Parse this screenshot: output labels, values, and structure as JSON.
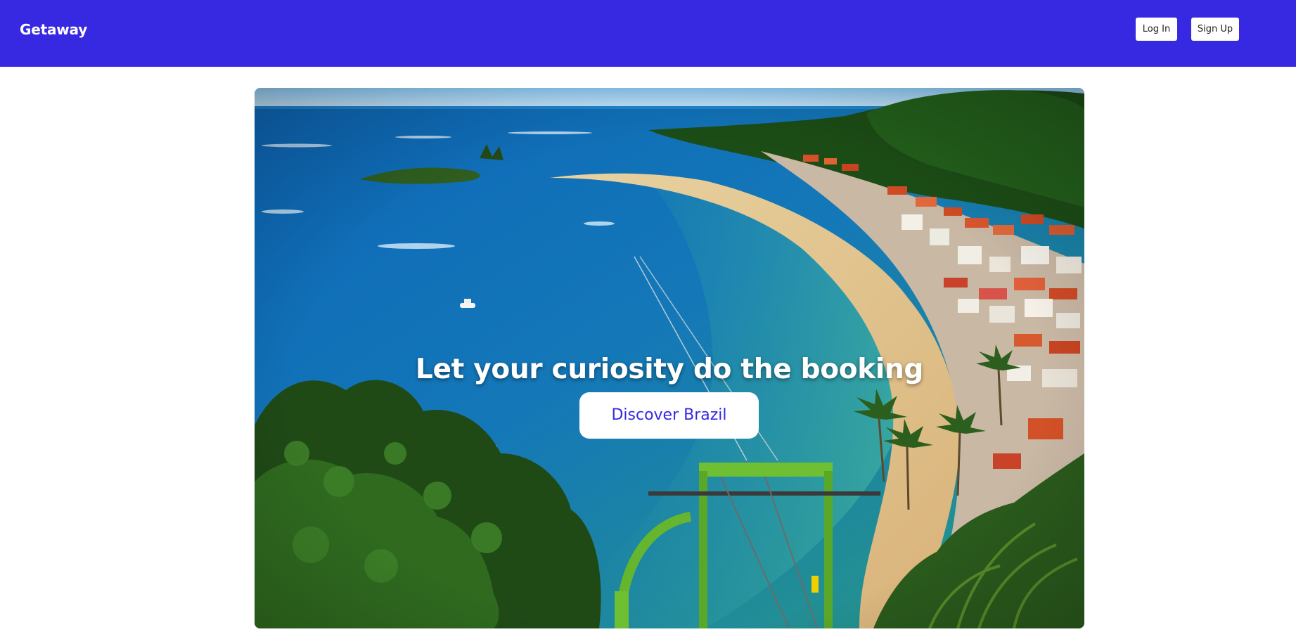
{
  "header": {
    "brand": "Getaway",
    "login_label": "Log In",
    "signup_label": "Sign Up"
  },
  "hero": {
    "title": "Let your curiosity do the booking",
    "cta_label": "Discover Brazil"
  },
  "colors": {
    "brand_blue": "#3629e1",
    "white": "#ffffff"
  }
}
